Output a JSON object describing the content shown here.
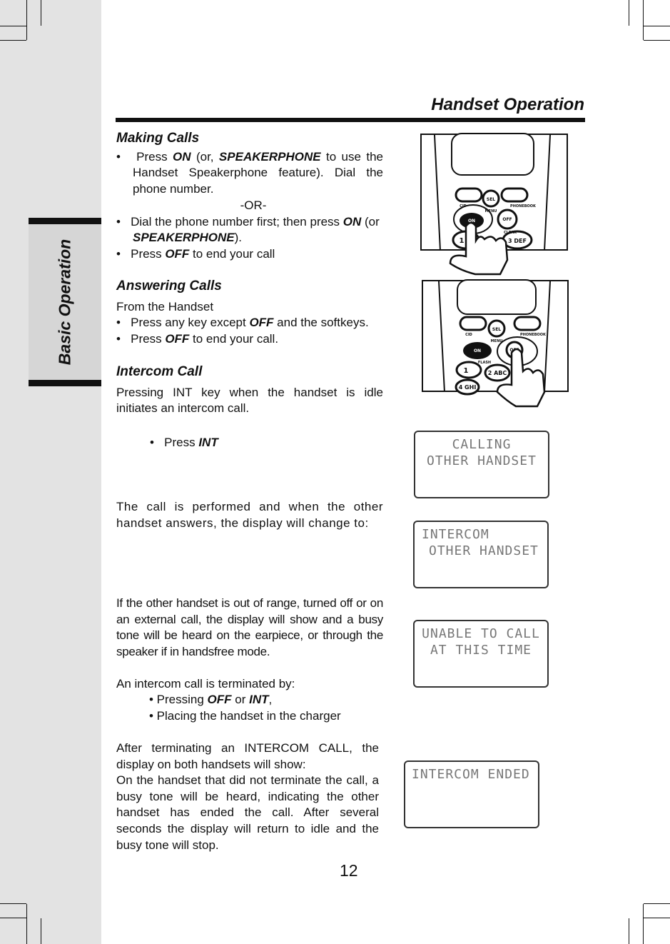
{
  "sidebar": {
    "tab_label": "Basic Operation"
  },
  "header": {
    "title": "Handset Operation"
  },
  "making_calls": {
    "heading": "Making Calls",
    "b1_pre": "Press ",
    "b1_on": "ON",
    "b1_mid": " (or, ",
    "b1_sp": "SPEAKERPHONE",
    "b1_post": " to use the Handset Speakerphone feature). Dial the phone number.",
    "or": "-OR-",
    "b2_pre": "Dial the phone number first; then press ",
    "b2_on": "ON",
    "b2_mid": " (or ",
    "b2_sp": "SPEAKERPHONE",
    "b2_post": ").",
    "b3_pre": "Press ",
    "b3_off": "OFF",
    "b3_post": " to end your call"
  },
  "answering_calls": {
    "heading": "Answering Calls",
    "sub": "From the Handset",
    "b1_pre": "Press any key except ",
    "b1_off": "OFF",
    "b1_post": " and the softkeys.",
    "b2_pre": "Press ",
    "b2_off": "OFF",
    "b2_post": " to end your call."
  },
  "intercom": {
    "heading": "Intercom Call",
    "intro": "Pressing INT key when the handset is idle initiates an intercom call.",
    "press_pre": "Press ",
    "press_int": "INT",
    "p2": "The call is performed and when the other handset answers, the display will change to:",
    "p3": "If the other handset is out of range, turned off or on an external call, the display will show and a busy tone will be heard on the earpiece, or through the speaker if in handsfree mode.",
    "p4": "An intercom call is terminated by:",
    "t1_pre": "• Pressing ",
    "t1_off": "OFF",
    "t1_mid": " or ",
    "t1_int": "INT",
    "t1_post": ",",
    "t2": "• Placing the handset in the charger",
    "p5": "After terminating an INTERCOM CALL, the display on both handsets will show:",
    "p6": "On the handset that did not terminate the call, a busy tone will be heard, indicating the other handset has ended the call. After several seconds the display will return to idle and the busy tone will stop."
  },
  "displays": [
    {
      "line1": "CALLING",
      "line2": "OTHER HANDSET"
    },
    {
      "line1": "INTERCOM",
      "line2": "OTHER HANDSET"
    },
    {
      "line1": "UNABLE TO CALL",
      "line2": "AT THIS TIME"
    },
    {
      "line1": "INTERCOM ENDED",
      "line2": ""
    }
  ],
  "illustrations": [
    {
      "keys": [
        "SEL",
        "MENU",
        "CID",
        "PHONEBOOK",
        "ON",
        "OFF",
        "CLEAR",
        "1",
        "3 DEF"
      ]
    },
    {
      "keys": [
        "SEL",
        "MENU",
        "CID",
        "PHONEBOOK",
        "ON",
        "FLASH",
        "OFF",
        "1",
        "2 ABC",
        "4 GHI"
      ]
    }
  ],
  "page_number": "12"
}
